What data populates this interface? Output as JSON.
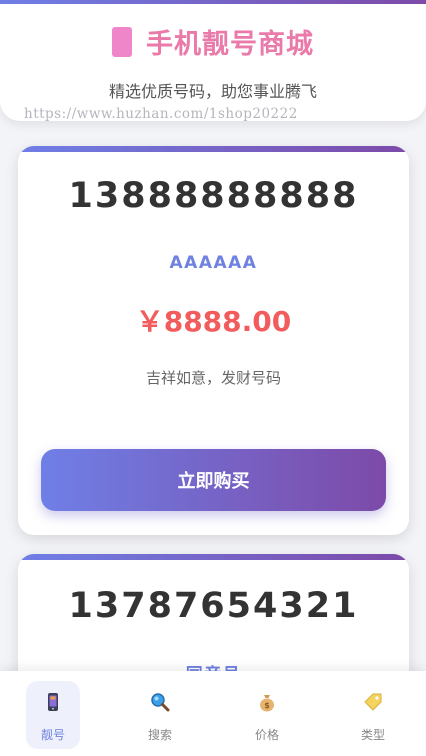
{
  "header": {
    "title": "手机靓号商城",
    "subtitle": "精选优质号码，助您事业腾飞",
    "watermark": "https://www.huzhan.com/1shop20222"
  },
  "listings": [
    {
      "number": "13888888888",
      "pattern": "AAAAAA",
      "price": "￥8888.00",
      "description": "吉祥如意，发财号码",
      "buy_label": "立即购买"
    },
    {
      "number": "13787654321",
      "pattern": "同音号"
    }
  ],
  "nav": {
    "items": [
      {
        "label": "靓号",
        "icon": "phone-icon",
        "active": true
      },
      {
        "label": "搜索",
        "icon": "magnifier-icon",
        "active": false
      },
      {
        "label": "价格",
        "icon": "money-bag-icon",
        "active": false
      },
      {
        "label": "类型",
        "icon": "tag-icon",
        "active": false
      }
    ]
  },
  "colors": {
    "accent_start": "#6f7fe6",
    "accent_end": "#7d4aa8",
    "title": "#e97aa9",
    "price": "#f25c5c",
    "pattern": "#6f82e0"
  }
}
